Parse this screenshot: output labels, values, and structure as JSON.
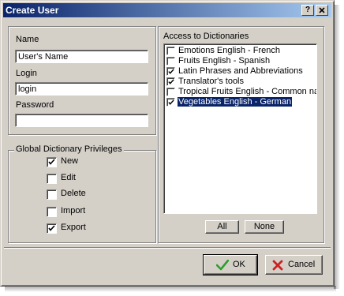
{
  "window": {
    "title": "Create User",
    "help_label": "?",
    "close_label": "X"
  },
  "user_form": {
    "name_label": "Name",
    "name_value": "User's Name",
    "login_label": "Login",
    "login_value": "login",
    "password_label": "Password",
    "password_value": ""
  },
  "privileges": {
    "title": "Global Dictionary Privileges",
    "items": [
      {
        "label": "New",
        "checked": true
      },
      {
        "label": "Edit",
        "checked": false
      },
      {
        "label": "Delete",
        "checked": false
      },
      {
        "label": "Import",
        "checked": false
      },
      {
        "label": "Export",
        "checked": true
      }
    ]
  },
  "dictionaries": {
    "title": "Access to Dictionaries",
    "items": [
      {
        "label": "Emotions English - French",
        "checked": false,
        "selected": false
      },
      {
        "label": "Fruits English - Spanish",
        "checked": false,
        "selected": false
      },
      {
        "label": "Latin Phrases and Abbreviations",
        "checked": true,
        "selected": false
      },
      {
        "label": "Translator's tools",
        "checked": true,
        "selected": false
      },
      {
        "label": "Tropical Fruits English - Common nar",
        "checked": false,
        "selected": false
      },
      {
        "label": "Vegetables English - German",
        "checked": true,
        "selected": true
      }
    ],
    "all_label": "All",
    "none_label": "None"
  },
  "footer": {
    "ok_label": "OK",
    "cancel_label": "Cancel"
  },
  "colors": {
    "ok_check": "#2e9e2e",
    "cancel_x": "#cc2222",
    "selection": "#0a246a"
  }
}
